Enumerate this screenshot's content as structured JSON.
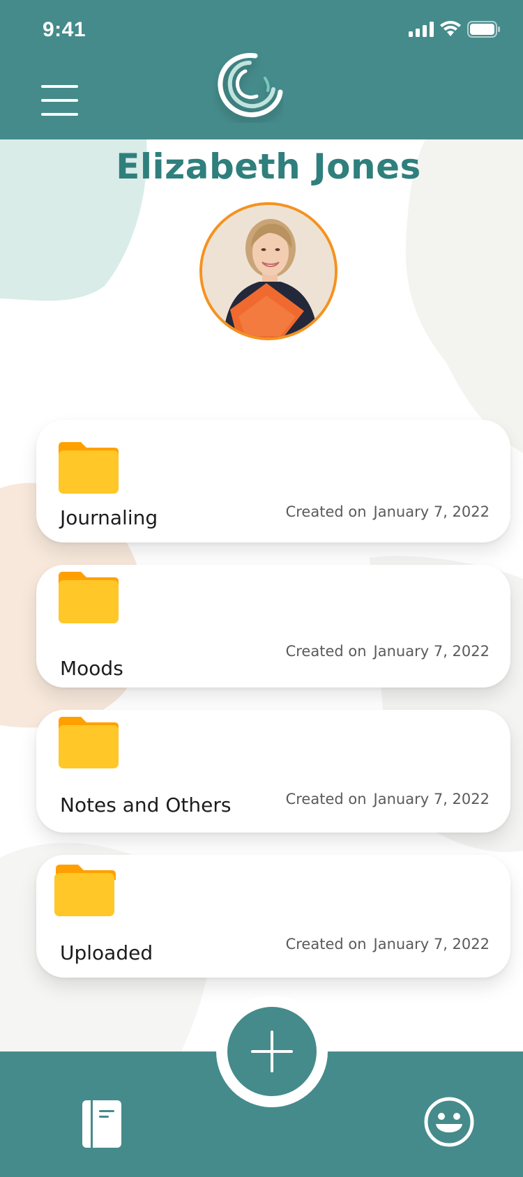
{
  "status_bar": {
    "time": "9:41"
  },
  "header": {
    "menu_icon": "hamburger-menu-icon",
    "logo_icon": "swirl-logo-icon"
  },
  "profile": {
    "name": "Elizabeth Jones",
    "avatar": "profile-photo"
  },
  "folders": [
    {
      "name": "Journaling",
      "created_label": "Created on",
      "date": "January 7, 2022",
      "icon": "folder-icon"
    },
    {
      "name": "Moods",
      "created_label": "Created on",
      "date": "January 7, 2022",
      "icon": "folder-icon"
    },
    {
      "name": "Notes and Others",
      "created_label": "Created on",
      "date": "January 7, 2022",
      "icon": "folder-icon"
    },
    {
      "name": "Uploaded",
      "created_label": "Created on",
      "date": "January 7, 2022",
      "icon": "folder-icon"
    }
  ],
  "bottom_nav": {
    "left_icon": "journal-book-icon",
    "center_icon": "plus-icon",
    "right_icon": "smiley-face-icon"
  },
  "colors": {
    "primary": "#458b8b",
    "title": "#2f7f7d",
    "folder": "#ffc727",
    "folder_tab": "#ffa000",
    "avatar_border": "#f5921e"
  }
}
